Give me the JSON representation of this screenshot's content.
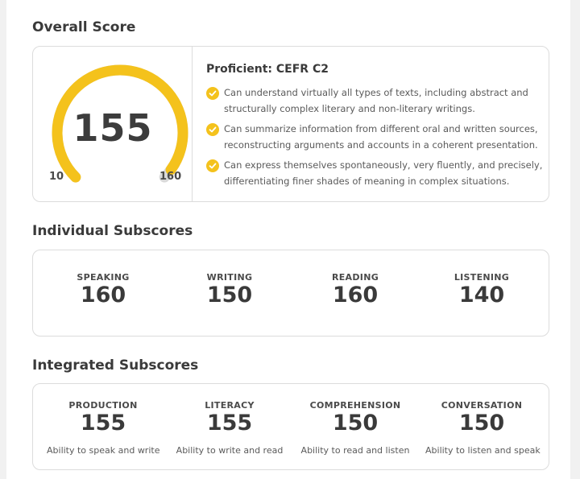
{
  "overall": {
    "title": "Overall Score",
    "score": "155",
    "score_value": 155,
    "min": "10",
    "max": "160",
    "level": "Proficient: CEFR C2",
    "descriptions": [
      "Can understand virtually all types of texts, including abstract and structurally complex literary and non-literary writings.",
      "Can summarize information from different oral and written sources, reconstructing arguments and accounts in a coherent presentation.",
      "Can express themselves spontaneously, very fluently, and precisely, differentiating finer shades of meaning in complex situations."
    ]
  },
  "individual": {
    "title": "Individual Subscores",
    "items": [
      {
        "label": "SPEAKING",
        "value": "160"
      },
      {
        "label": "WRITING",
        "value": "150"
      },
      {
        "label": "READING",
        "value": "160"
      },
      {
        "label": "LISTENING",
        "value": "140"
      }
    ]
  },
  "integrated": {
    "title": "Integrated Subscores",
    "items": [
      {
        "label": "PRODUCTION",
        "value": "155",
        "desc": "Ability to speak and write"
      },
      {
        "label": "LITERACY",
        "value": "155",
        "desc": "Ability to write and read"
      },
      {
        "label": "COMPREHENSION",
        "value": "150",
        "desc": "Ability to read and listen"
      },
      {
        "label": "CONVERSATION",
        "value": "150",
        "desc": "Ability to listen and speak"
      }
    ]
  },
  "colors": {
    "accent": "#f4c21c",
    "track": "#d9d9d9"
  }
}
